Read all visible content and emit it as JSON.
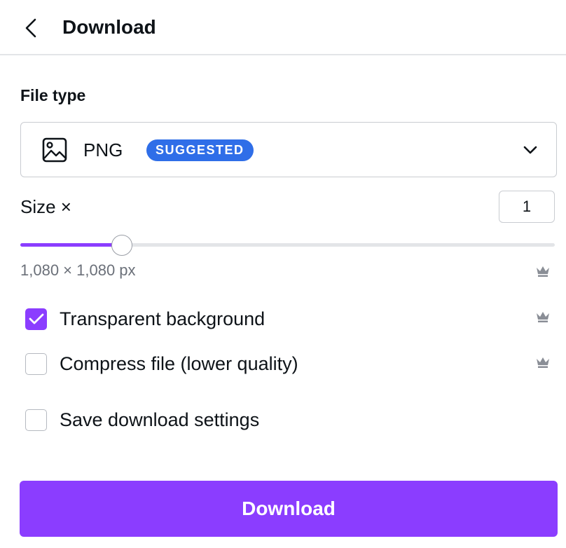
{
  "header": {
    "title": "Download",
    "back_icon": "chevron-left-icon"
  },
  "file_type": {
    "label": "File type",
    "selected": "PNG",
    "icon": "image-icon",
    "badge": "SUGGESTED",
    "badge_color": "#2f6ee8"
  },
  "size": {
    "label": "Size ×",
    "value": "1",
    "slider_fraction": 0.19,
    "dimensions": "1,080 × 1,080 px"
  },
  "options": [
    {
      "label": "Transparent background",
      "checked": true,
      "pro": true
    },
    {
      "label": "Compress file (lower quality)",
      "checked": false,
      "pro": true
    },
    {
      "label": "Save download settings",
      "checked": false,
      "pro": false
    }
  ],
  "download_button": {
    "label": "Download"
  },
  "colors": {
    "accent": "#8b3dff",
    "border": "#c9ccd1",
    "muted": "#6b7079"
  }
}
